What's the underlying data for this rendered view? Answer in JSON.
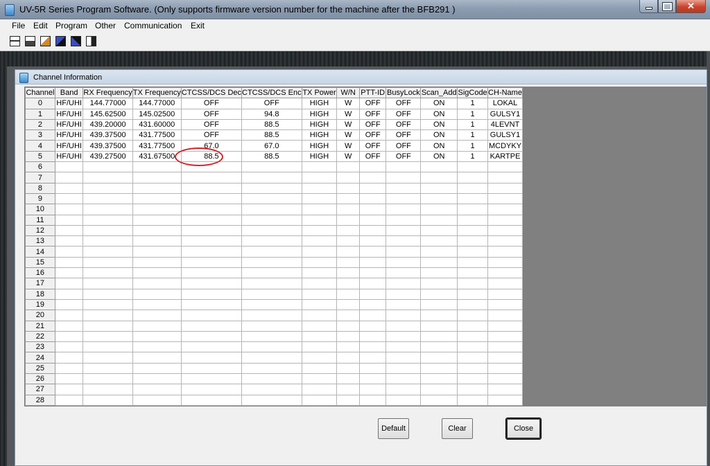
{
  "window": {
    "title": "UV-5R Series Program Software. (Only supports firmware version number for the machine after the BFB291 )"
  },
  "menu": [
    "File",
    "Edit",
    "Program",
    "Other",
    "Communication",
    "Exit"
  ],
  "toolbar_icons": [
    "read-radio-icon",
    "save-icon",
    "open-icon",
    "upload-icon",
    "download-icon",
    "exit-icon"
  ],
  "child": {
    "title": "Channel Information"
  },
  "table": {
    "columns": [
      "Channel",
      "Band",
      "RX Frequency",
      "TX Frequency",
      "CTCSS/DCS Dec",
      "CTCSS/DCS Enc",
      "TX Power",
      "W/N",
      "PTT-ID",
      "BusyLock",
      "Scan_Add",
      "SigCode",
      "CH-Name"
    ],
    "rows": [
      [
        "0",
        "HF/UHI",
        "144.77000",
        "144.77000",
        "OFF",
        "OFF",
        "HIGH",
        "W",
        "OFF",
        "OFF",
        "ON",
        "1",
        "LOKAL"
      ],
      [
        "1",
        "HF/UHI",
        "145.62500",
        "145.02500",
        "OFF",
        "94.8",
        "HIGH",
        "W",
        "OFF",
        "OFF",
        "ON",
        "1",
        "GULSY1"
      ],
      [
        "2",
        "HF/UHI",
        "439.20000",
        "431.60000",
        "OFF",
        "88.5",
        "HIGH",
        "W",
        "OFF",
        "OFF",
        "ON",
        "1",
        "4LEVNT"
      ],
      [
        "3",
        "HF/UHI",
        "439.37500",
        "431.77500",
        "OFF",
        "88.5",
        "HIGH",
        "W",
        "OFF",
        "OFF",
        "ON",
        "1",
        "GULSY1"
      ],
      [
        "4",
        "HF/UHI",
        "439.37500",
        "431.77500",
        "67.0",
        "67.0",
        "HIGH",
        "W",
        "OFF",
        "OFF",
        "ON",
        "1",
        "MCDYKY"
      ],
      [
        "5",
        "HF/UHI",
        "439.27500",
        "431.67500",
        "88.5",
        "88.5",
        "HIGH",
        "W",
        "OFF",
        "OFF",
        "ON",
        "1",
        "KARTPE"
      ],
      [
        "6"
      ],
      [
        "7"
      ],
      [
        "8"
      ],
      [
        "9"
      ],
      [
        "10"
      ],
      [
        "11"
      ],
      [
        "12"
      ],
      [
        "13"
      ],
      [
        "14"
      ],
      [
        "15"
      ],
      [
        "16"
      ],
      [
        "17"
      ],
      [
        "18"
      ],
      [
        "19"
      ],
      [
        "20"
      ],
      [
        "21"
      ],
      [
        "22"
      ],
      [
        "23"
      ],
      [
        "24"
      ],
      [
        "25"
      ],
      [
        "26"
      ],
      [
        "27"
      ],
      [
        "28"
      ]
    ]
  },
  "buttons": {
    "default": "Default",
    "clear": "Clear",
    "close": "Close"
  },
  "colors": {
    "highlight": "#d0232a",
    "titlebar": "#8d9db1"
  }
}
